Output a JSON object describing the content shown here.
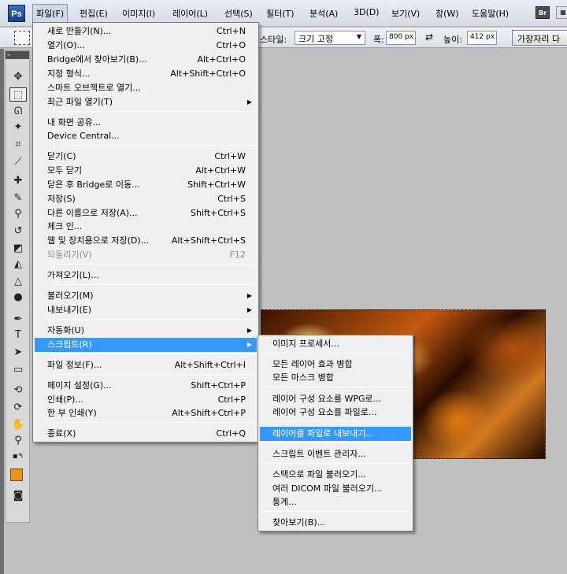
{
  "menubar": {
    "logo": "Ps",
    "items": [
      "파일(F)",
      "편집(E)",
      "이미지(I)",
      "레이어(L)",
      "선택(S)",
      "필터(T)",
      "분석(A)",
      "3D(D)",
      "보기(V)",
      "창(W)",
      "도움말(H)"
    ],
    "bridge_button": "Br"
  },
  "options": {
    "style_label": "스타일:",
    "style_value": "크기 고정",
    "width_label": "폭:",
    "width_value": "800 px",
    "height_label": "높이:",
    "height_value": "412 px",
    "edge_button": "가장자리 다"
  },
  "file_menu": {
    "items": [
      {
        "label": "새로 만들기(N)...",
        "shortcut": "Ctrl+N"
      },
      {
        "label": "열기(O)...",
        "shortcut": "Ctrl+O"
      },
      {
        "label": "Bridge에서 찾아보기(B)...",
        "shortcut": "Alt+Ctrl+O"
      },
      {
        "label": "지정 형식...",
        "shortcut": "Alt+Shift+Ctrl+O"
      },
      {
        "label": "스마트 오브젝트로 열기...",
        "shortcut": ""
      },
      {
        "label": "최근 파일 열기(T)",
        "shortcut": ""
      },
      {
        "label": "내 화면 공유...",
        "shortcut": ""
      },
      {
        "label": "Device Central...",
        "shortcut": ""
      },
      {
        "label": "닫기(C)",
        "shortcut": "Ctrl+W"
      },
      {
        "label": "모두 닫기",
        "shortcut": "Alt+Ctrl+W"
      },
      {
        "label": "닫은 후 Bridge로 이동...",
        "shortcut": "Shift+Ctrl+W"
      },
      {
        "label": "저장(S)",
        "shortcut": "Ctrl+S"
      },
      {
        "label": "다른 이름으로 저장(A)...",
        "shortcut": "Shift+Ctrl+S"
      },
      {
        "label": "체크 인...",
        "shortcut": ""
      },
      {
        "label": "웹 및 장치용으로 저장(D)...",
        "shortcut": "Alt+Shift+Ctrl+S"
      },
      {
        "label": "되돌리기(V)",
        "shortcut": "F12"
      },
      {
        "label": "가져오기(L)...",
        "shortcut": ""
      },
      {
        "label": "불러오기(M)",
        "shortcut": ""
      },
      {
        "label": "내보내기(E)",
        "shortcut": ""
      },
      {
        "label": "자동화(U)",
        "shortcut": ""
      },
      {
        "label": "스크립트(R)",
        "shortcut": ""
      },
      {
        "label": "파일 정보(F)...",
        "shortcut": "Alt+Shift+Ctrl+I"
      },
      {
        "label": "페이지 설정(G)...",
        "shortcut": "Shift+Ctrl+P"
      },
      {
        "label": "인쇄(P)...",
        "shortcut": "Ctrl+P"
      },
      {
        "label": "한 부 인쇄(Y)",
        "shortcut": "Alt+Shift+Ctrl+P"
      },
      {
        "label": "종료(X)",
        "shortcut": "Ctrl+Q"
      }
    ]
  },
  "scripts_menu": {
    "items": [
      {
        "label": "이미지 프로세서..."
      },
      {
        "label": "모든 레이어 효과 병합"
      },
      {
        "label": "모든 마스크 병합"
      },
      {
        "label": "레이어 구성 요소를 WPG로..."
      },
      {
        "label": "레이어 구성 요소를 파일로..."
      },
      {
        "label": "레이어를 파일로 내보내기..."
      },
      {
        "label": "스크립트 이벤트 관리자..."
      },
      {
        "label": "스택으로 파일 불러오기..."
      },
      {
        "label": "여러 DICOM 파일 불러오기..."
      },
      {
        "label": "통계..."
      },
      {
        "label": "찾아보기(B)..."
      }
    ]
  },
  "colors": {
    "highlight": "#3399ff",
    "foreground_swatch": "#e8960e",
    "background_swatch": "#ffffff"
  },
  "icons": [
    "move-icon",
    "marquee-icon",
    "lasso-icon",
    "magic-wand-icon",
    "crop-icon",
    "eyedropper-icon",
    "healing-brush-icon",
    "brush-icon",
    "clone-stamp-icon",
    "history-brush-icon",
    "eraser-icon",
    "gradient-icon",
    "blur-icon",
    "dodge-icon",
    "pen-icon",
    "type-icon",
    "path-select-icon",
    "shape-icon",
    "3d-rotate-icon",
    "3d-orbit-icon",
    "hand-icon",
    "zoom-icon",
    "quick-mask-icon"
  ]
}
